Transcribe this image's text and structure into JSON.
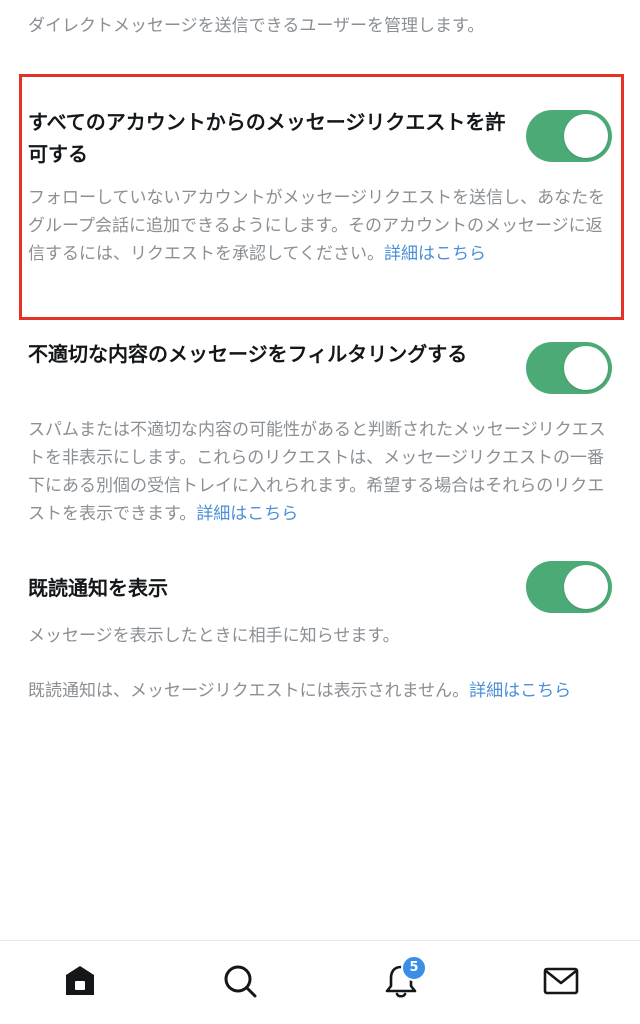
{
  "intro": "ダイレクトメッセージを送信できるユーザーを管理します。",
  "sections": [
    {
      "title": "すべてのアカウントからのメッセージリクエストを許可する",
      "description": "フォローしていないアカウントがメッセージリクエストを送信し、あなたをグループ会話に追加できるようにします。そのアカウントのメッセージに返信するには、リクエストを承認してください。",
      "link": "詳細はこちら",
      "enabled": true
    },
    {
      "title": "不適切な内容のメッセージをフィルタリングする",
      "description": "スパムまたは不適切な内容の可能性があると判断されたメッセージリクエストを非表示にします。これらのリクエストは、メッセージリクエストの一番下にある別個の受信トレイに入れられます。希望する場合はそれらのリクエストを表示できます。",
      "link": "詳細はこちら",
      "enabled": true
    },
    {
      "title": "既読通知を表示",
      "description": "メッセージを表示したときに相手に知らせます。",
      "note": "既読通知は、メッセージリクエストには表示されません。",
      "link": "詳細はこちら",
      "enabled": true
    }
  ],
  "tabbar": {
    "items": [
      {
        "icon": "home-icon"
      },
      {
        "icon": "search-icon"
      },
      {
        "icon": "notifications-icon",
        "badge": "5"
      },
      {
        "icon": "messages-icon"
      }
    ]
  },
  "colors": {
    "toggle_on": "#4caa76",
    "link": "#4a8fd8",
    "highlight": "#e4322b",
    "badge": "#3a8ee6"
  }
}
